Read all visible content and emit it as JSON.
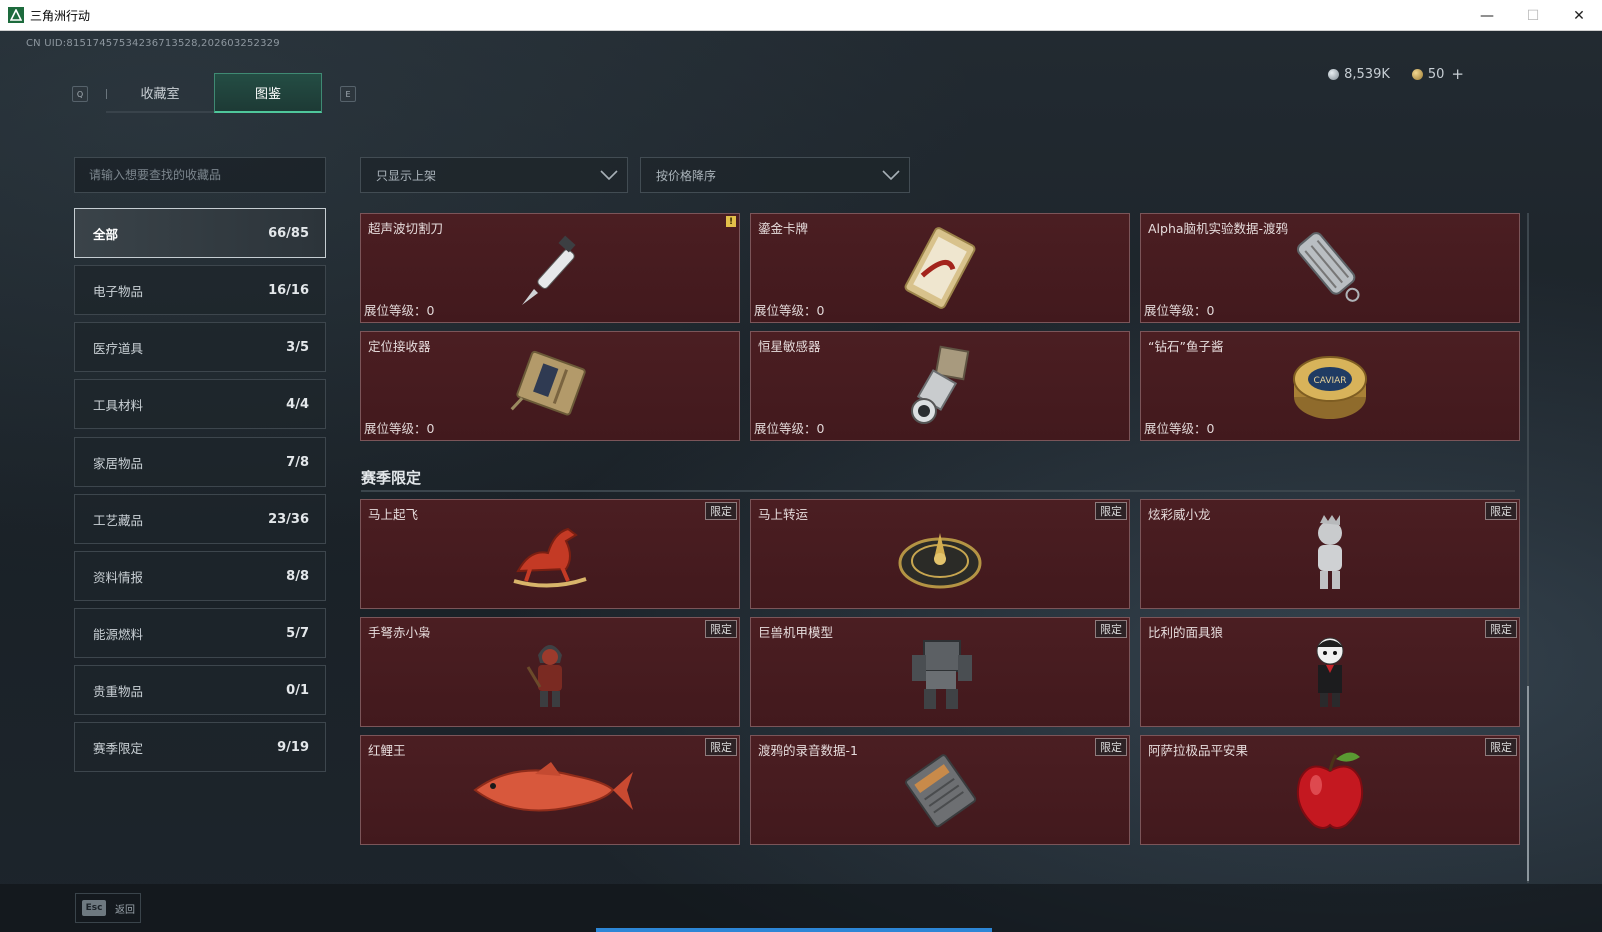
{
  "window": {
    "title": "三角洲行动",
    "minimize": "—",
    "maximize": "☐",
    "close": "✕"
  },
  "uid": "CN UID:815174575342367135​28,202603252329",
  "tabs": {
    "prev_key": "Q",
    "next_key": "E",
    "items": [
      {
        "label": "收藏室",
        "active": false
      },
      {
        "label": "图鉴",
        "active": true
      }
    ]
  },
  "currency": {
    "silver": "8,539K",
    "gold": "50",
    "plus": "+"
  },
  "search": {
    "placeholder": "请输入想要查找的收藏品"
  },
  "categories": [
    {
      "label": "全部",
      "count": "66/85",
      "active": true
    },
    {
      "label": "电子物品",
      "count": "16/16"
    },
    {
      "label": "医疗道具",
      "count": "3/5"
    },
    {
      "label": "工具材料",
      "count": "4/4"
    },
    {
      "label": "家居物品",
      "count": "7/8"
    },
    {
      "label": "工艺藏品",
      "count": "23/36"
    },
    {
      "label": "资料情报",
      "count": "8/8"
    },
    {
      "label": "能源燃料",
      "count": "5/7"
    },
    {
      "label": "贵重物品",
      "count": "0/1"
    },
    {
      "label": "赛季限定",
      "count": "9/19"
    }
  ],
  "filters": {
    "display": "只显示上架",
    "sort": "按价格降序"
  },
  "items": [
    {
      "name": "超声波切割刀",
      "level": "展位等级：0",
      "icon": "knife-icon",
      "warning": "!"
    },
    {
      "name": "鎏金卡牌",
      "level": "展位等级：0",
      "icon": "card-icon"
    },
    {
      "name": "Alpha脑机实验数据-渡鸦",
      "level": "展位等级：0",
      "icon": "data-capsule-icon"
    },
    {
      "name": "定位接收器",
      "level": "展位等级：0",
      "icon": "receiver-icon"
    },
    {
      "name": "恒星敏感器",
      "level": "展位等级：0",
      "icon": "star-sensor-icon"
    },
    {
      "name": "“钻石”鱼子酱",
      "level": "展位等级：0",
      "icon": "caviar-tin-icon",
      "caviar_label": "CAVIAR"
    }
  ],
  "section_title": "赛季限定",
  "limited_badge": "限定",
  "limited_items": [
    {
      "name": "马上起飞",
      "icon": "horse-icon"
    },
    {
      "name": "马上转运",
      "icon": "compass-icon"
    },
    {
      "name": "炫彩威小龙",
      "icon": "dragon-figure-icon"
    },
    {
      "name": "手弩赤小枭",
      "icon": "crossbow-figure-icon"
    },
    {
      "name": "巨兽机甲模型",
      "icon": "mech-icon"
    },
    {
      "name": "比利的面具狼",
      "icon": "puppet-icon"
    },
    {
      "name": "红鲤王",
      "icon": "carp-icon"
    },
    {
      "name": "渡鸦的录音数据-1",
      "icon": "recorder-icon"
    },
    {
      "name": "阿萨拉极品平安果",
      "icon": "apple-icon"
    }
  ],
  "footer": {
    "esc_key": "Esc",
    "back_label": "返回"
  }
}
